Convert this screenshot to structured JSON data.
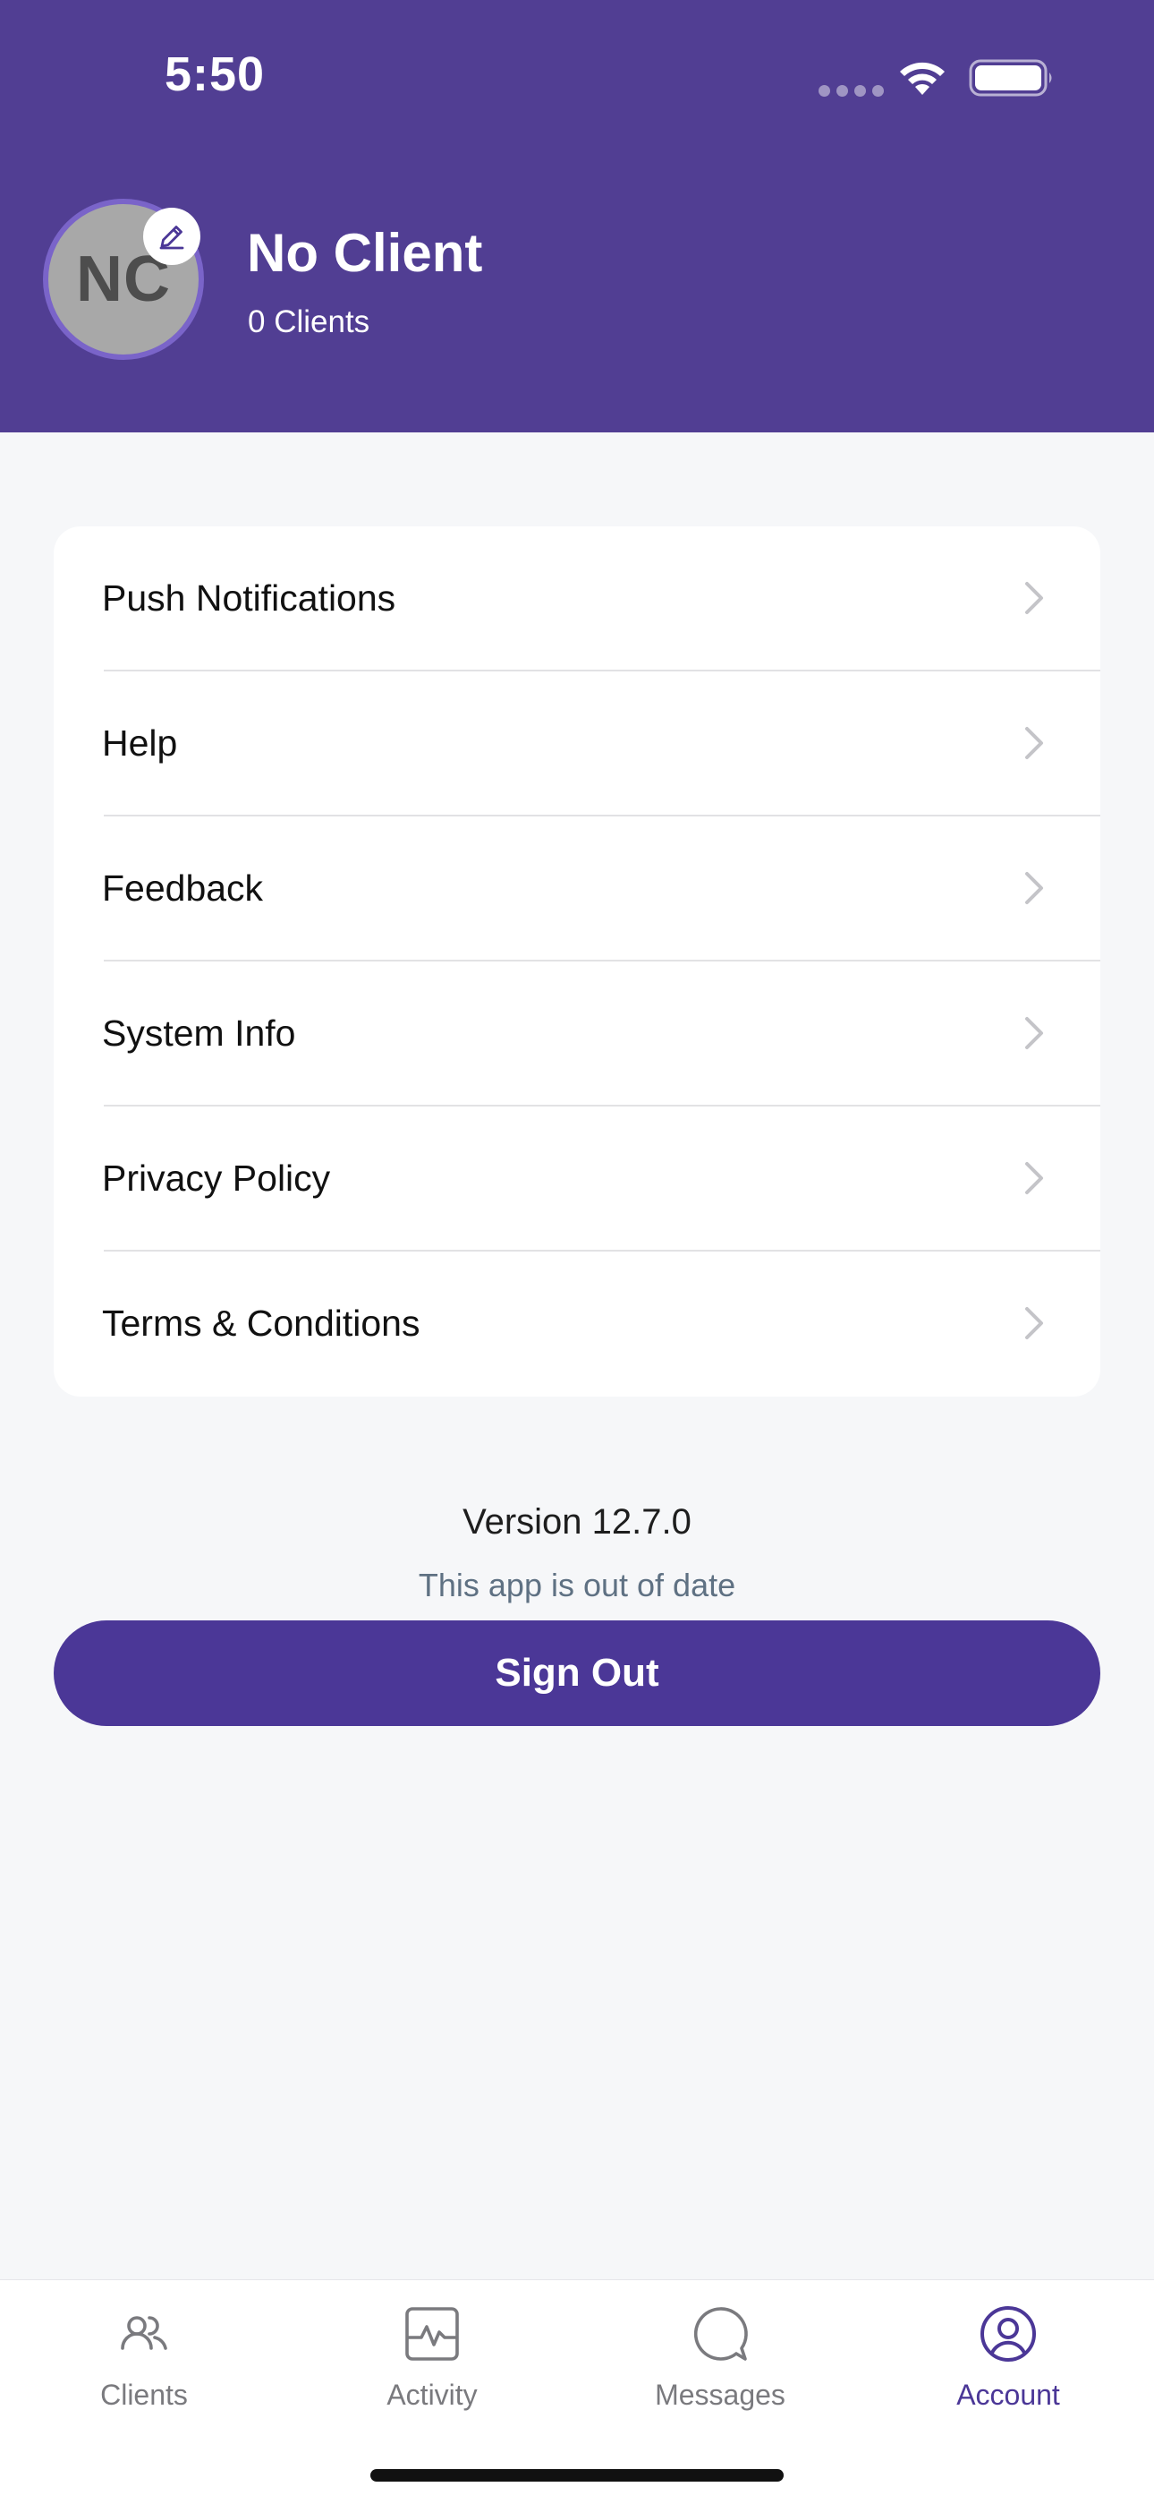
{
  "status_bar": {
    "time": "5:50"
  },
  "profile": {
    "initials": "NC",
    "name": "No Client",
    "client_count": "0 Clients"
  },
  "menu": {
    "items": [
      {
        "label": "Push Notifications"
      },
      {
        "label": "Help"
      },
      {
        "label": "Feedback"
      },
      {
        "label": "System Info"
      },
      {
        "label": "Privacy Policy"
      },
      {
        "label": "Terms & Conditions"
      }
    ]
  },
  "footer": {
    "version": "Version 12.7.0",
    "outdated_notice": "This app is out of date",
    "sign_out_label": "Sign Out"
  },
  "tabbar": {
    "tabs": [
      {
        "label": "Clients",
        "icon": "clients-icon"
      },
      {
        "label": "Activity",
        "icon": "activity-icon"
      },
      {
        "label": "Messages",
        "icon": "messages-icon"
      },
      {
        "label": "Account",
        "icon": "account-icon",
        "active": true
      }
    ]
  },
  "colors": {
    "header": "#513e93",
    "primary": "#4b3797",
    "background": "#f6f7f9",
    "avatar": "#a8a8a8",
    "muted_text": "#5f7183"
  }
}
